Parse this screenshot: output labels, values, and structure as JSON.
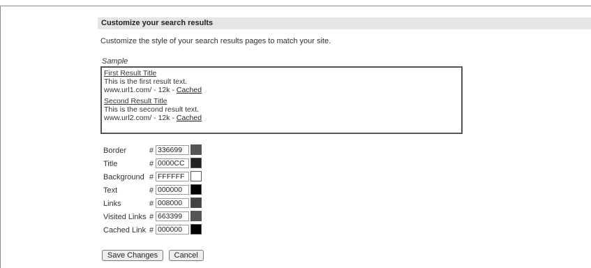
{
  "header": {
    "title": "Customize your search results"
  },
  "intro": "Customize the style of your search results pages to match your site.",
  "sample": {
    "label": "Sample",
    "results": [
      {
        "title": "First Result Title",
        "text": "This is the first result text.",
        "meta": "www.url1.com/ - 12k - ",
        "cached": "Cached"
      },
      {
        "title": "Second Result Title",
        "text": "This is the second result text.",
        "meta": "www.url2.com/ - 12k - ",
        "cached": "Cached"
      }
    ]
  },
  "colors": [
    {
      "label": "Border",
      "hash": "#",
      "value": "336699",
      "swatch": "#555555"
    },
    {
      "label": "Title",
      "hash": "#",
      "value": "0000CC",
      "swatch": "#222222"
    },
    {
      "label": "Background",
      "hash": "#",
      "value": "FFFFFF",
      "swatch": "#ffffff"
    },
    {
      "label": "Text",
      "hash": "#",
      "value": "000000",
      "swatch": "#000000"
    },
    {
      "label": "Links",
      "hash": "#",
      "value": "008000",
      "swatch": "#444444"
    },
    {
      "label": "Visited Links",
      "hash": "#",
      "value": "663399",
      "swatch": "#555555"
    },
    {
      "label": "Cached Link",
      "hash": "#",
      "value": "000000",
      "swatch": "#000000"
    }
  ],
  "buttons": {
    "save": "Save Changes",
    "cancel": "Cancel"
  }
}
